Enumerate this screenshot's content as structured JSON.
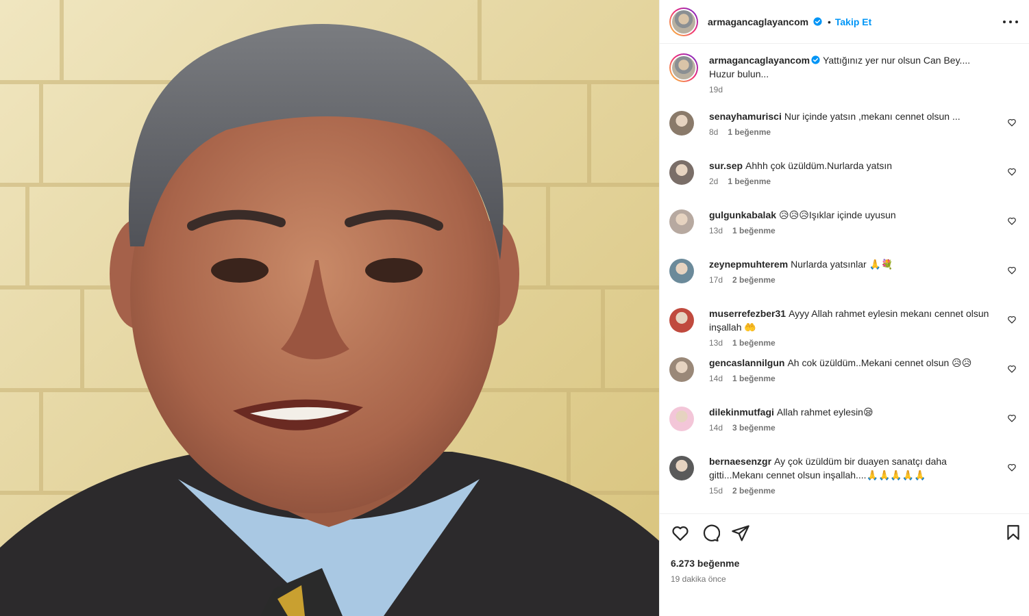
{
  "post": {
    "username": "armagancaglayancom",
    "dot": "•",
    "follow_label": "Takip Et",
    "caption_text": "Yattığınız yer nur olsun Can Bey.... Huzur bulun...",
    "caption_time": "19d",
    "total_likes": "6.273 beğenme",
    "time_ago": "19 dakika önce"
  },
  "comments": [
    {
      "user": "senayhamurisci",
      "text": "Nur içinde yatsın ,mekanı cennet olsun ...",
      "time": "8d",
      "likes": "1 beğenme",
      "avatar_color": "#8a7a6a"
    },
    {
      "user": "sur.sep",
      "text": "Ahhh çok üzüldüm.Nurlarda yatsın",
      "time": "2d",
      "likes": "1 beğenme",
      "avatar_color": "#7a6e68"
    },
    {
      "user": "gulgunkabalak",
      "text": "😥😥😥Işıklar içinde uyusun",
      "time": "13d",
      "likes": "1 beğenme",
      "avatar_color": "#b7a9a0"
    },
    {
      "user": "zeynepmuhterem",
      "text": "Nurlarda yatsınlar 🙏💐",
      "time": "17d",
      "likes": "2 beğenme",
      "avatar_color": "#6b8a9a"
    },
    {
      "user": "muserrefezber31",
      "text": "Ayyy Allah rahmet eylesin mekanı cennet olsun inşallah 🤲",
      "time": "13d",
      "likes": "1 beğenme",
      "avatar_color": "#c04a3e"
    },
    {
      "user": "gencaslannilgun",
      "text": "Ah cok üzüldüm..Mekani cennet olsun 😥😥",
      "time": "14d",
      "likes": "1 beğenme",
      "avatar_color": "#9a8878"
    },
    {
      "user": "dilekinmutfagi",
      "text": "Allah rahmet eylesin😪",
      "time": "14d",
      "likes": "3 beğenme",
      "avatar_color": "#f3c6d8"
    },
    {
      "user": "bernaesenzgr",
      "text": "Ay çok üzüldüm bir duayen sanatçı daha gitti...Mekanı cennet olsun inşallah....🙏🙏🙏🙏🙏",
      "time": "15d",
      "likes": "2 beğenme",
      "avatar_color": "#5a5a5a"
    }
  ],
  "colors": {
    "accent": "#0095f6",
    "verified": "#0095f6",
    "muted": "#737373"
  },
  "icons": [
    "verified-icon",
    "more-options-icon",
    "heart-icon",
    "comment-icon",
    "share-icon",
    "save-icon"
  ]
}
